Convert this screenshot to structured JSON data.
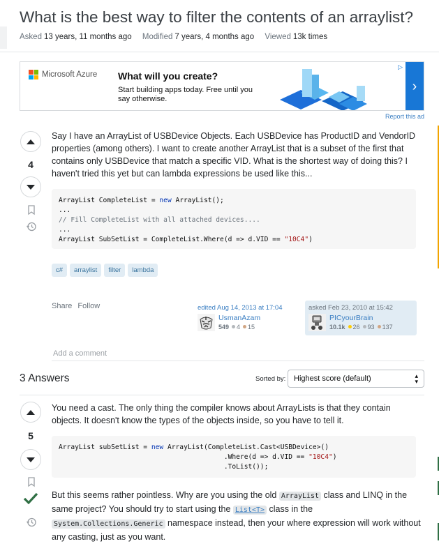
{
  "question": {
    "title": "What is the best way to filter the contents of an arraylist?",
    "meta": {
      "asked_label": "Asked",
      "asked_value": "13 years, 11 months ago",
      "modified_label": "Modified",
      "modified_value": "7 years, 4 months ago",
      "viewed_label": "Viewed",
      "viewed_value": "13k times"
    },
    "score": "4",
    "body": "Say I have an ArrayList of USBDevice Objects. Each USBDevice has ProductID and VendorID properties (among others). I want to create another ArrayList that is a subset of the first that contains only USBDevice that match a specific VID. What is the shortest way of doing this? I haven't tried this yet but can lambda expressions be used like this...",
    "code": {
      "l1_a": "ArrayList CompleteList = ",
      "l1_kw": "new",
      "l1_b": " ArrayList();",
      "l2": "...",
      "l3": "// Fill CompleteList with all attached devices....",
      "l4": "...",
      "l5_a": "ArrayList SubSetList = CompleteList.Where(d => d.VID == ",
      "l5_str": "\"10C4\"",
      "l5_b": ")"
    },
    "tags": [
      "c#",
      "arraylist",
      "filter",
      "lambda"
    ],
    "share_label": "Share",
    "follow_label": "Follow",
    "edited": {
      "label": "edited Aug 14, 2013 at 17:04",
      "user": "UsmanAzam",
      "rep": "549",
      "silver": "4",
      "bronze": "15"
    },
    "asked_card": {
      "label": "asked Feb 23, 2010 at 15:42",
      "user": "PICyourBrain",
      "rep": "10.1k",
      "gold": "26",
      "silver": "93",
      "bronze": "137"
    },
    "add_comment": "Add a comment"
  },
  "ad": {
    "brand": "Microsoft Azure",
    "headline": "What will you create?",
    "text": "Start building apps today. Free until you say otherwise.",
    "report": "Report this ad"
  },
  "answers": {
    "heading": "3 Answers",
    "sorted_label": "Sorted by:",
    "sort_value": "Highest score (default)",
    "first": {
      "score": "5",
      "p1": "You need a cast. The only thing the compiler knows about ArrayLists is that they contain objects. It doesn't know the types of the objects inside, so you have to tell it.",
      "code": {
        "l1_a": "ArrayList subSetList = ",
        "l1_kw": "new",
        "l1_b": " ArrayList(CompleteList.Cast<USBDevice>()",
        "l2_a": "                                         .Where(d => d.VID == ",
        "l2_str": "\"10C4\"",
        "l2_b": ")",
        "l3": "                                         .ToList());"
      },
      "p2_a": "But this seems rather pointless. Why are you using the old ",
      "p2_c1": "ArrayList",
      "p2_b": " class and LINQ in the same project? You should try to start using the ",
      "p2_link": "List<T>",
      "p2_c": " class in the ",
      "p2_c2": "System.Collections.Generic",
      "p2_d": " namespace instead, then your where expression will work without any casting, just as you want."
    }
  },
  "colors": {
    "accent": "#3a7ec2",
    "tag_bg": "#e1ecf4",
    "accepted": "#2f6f44",
    "ad_blue": "#1877d6"
  }
}
